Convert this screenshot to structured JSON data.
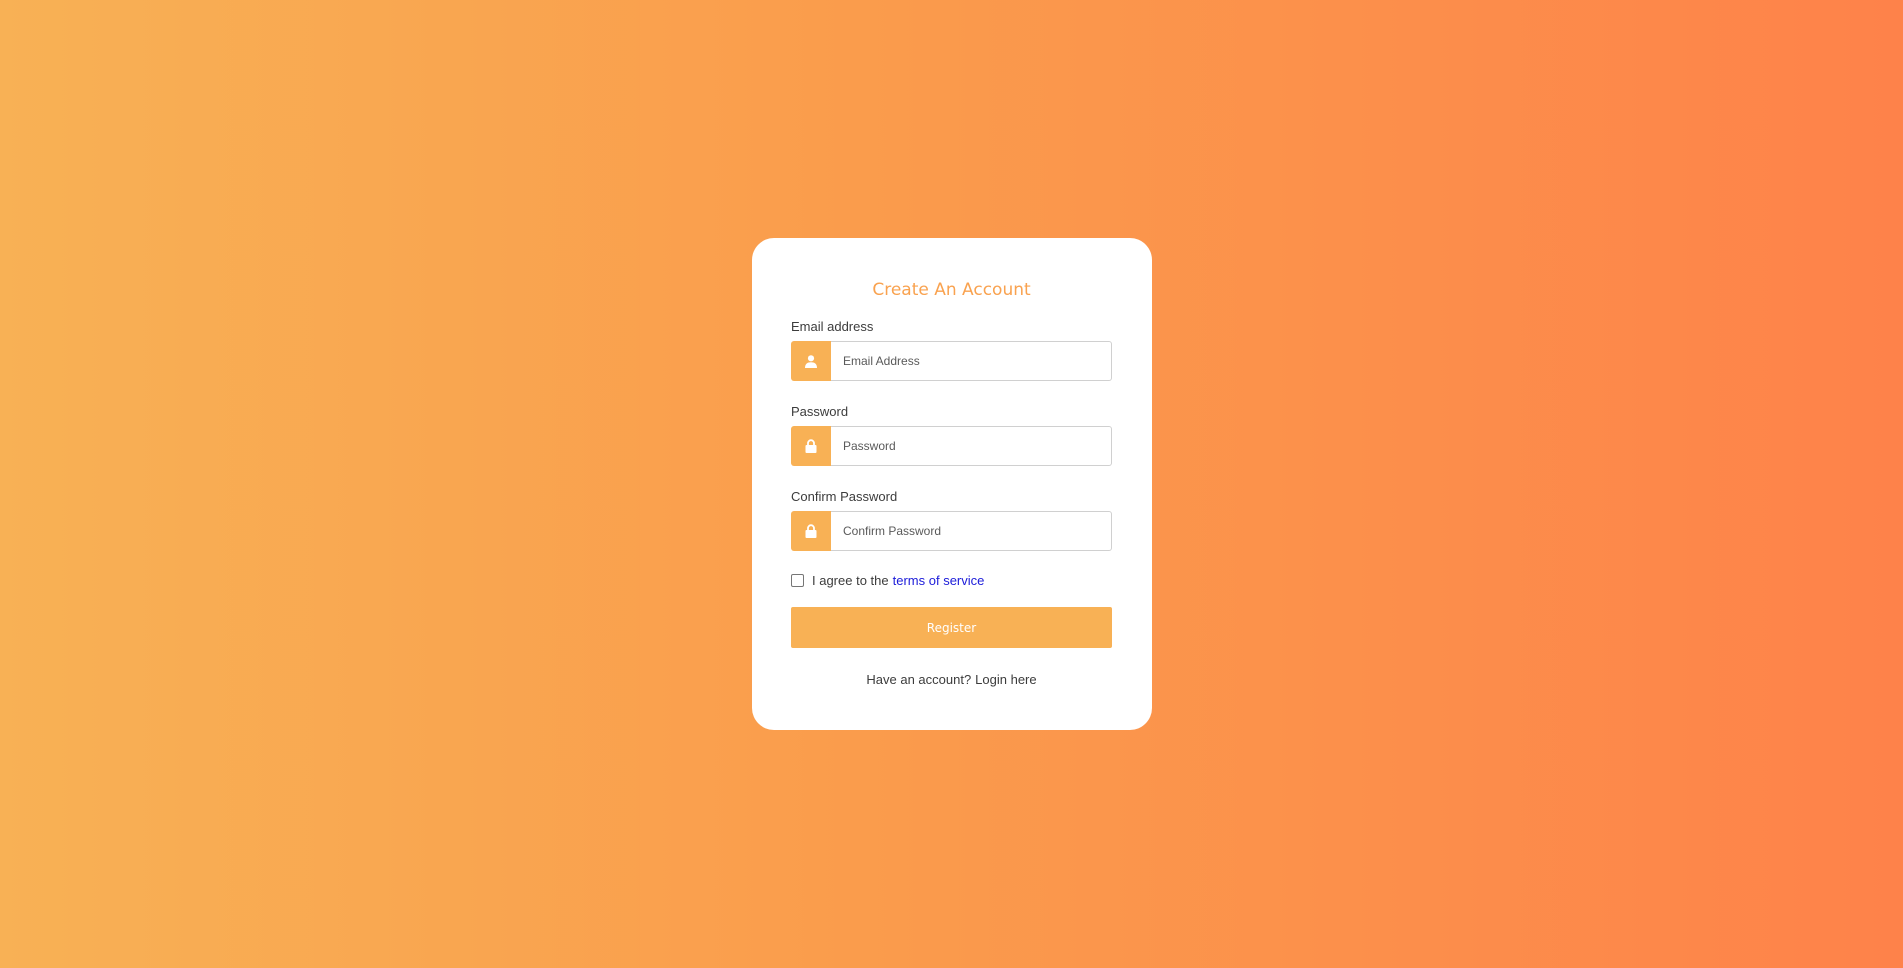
{
  "page": {
    "title": "Create An Account",
    "background_gradient": [
      "#f8b155",
      "#fe824a"
    ],
    "accent_color": "#f8b155"
  },
  "form": {
    "email": {
      "label": "Email address",
      "placeholder": "Email Address",
      "value": "",
      "icon": "user-icon"
    },
    "password": {
      "label": "Password",
      "placeholder": "Password",
      "value": "",
      "icon": "lock-icon"
    },
    "confirm_password": {
      "label": "Confirm Password",
      "placeholder": "Confirm Password",
      "value": "",
      "icon": "lock-icon"
    },
    "terms": {
      "checked": false,
      "text": "I agree to the",
      "link_text": "terms of service",
      "link_color": "#1b1bd9"
    },
    "register_label": "Register",
    "login_prompt": "Have an account?",
    "login_link": "Login here"
  }
}
